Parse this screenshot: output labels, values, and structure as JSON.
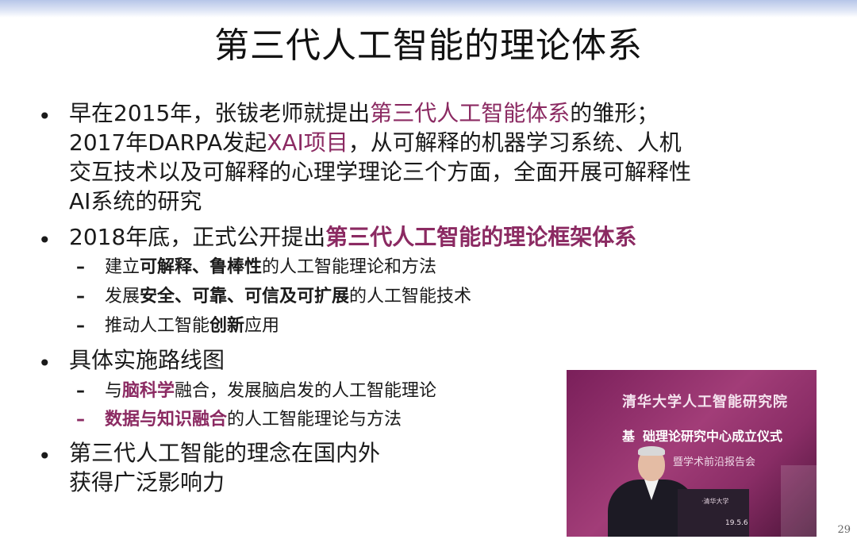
{
  "title": "第三代人工智能的理论体系",
  "bullets": [
    {
      "lines": [
        {
          "pre": "早在2015年，张钹老师就提出",
          "hl": "第三代人工智能体系",
          "post": "的雏形；"
        },
        {
          "pre": "2017年DARPA发起",
          "hl": "XAI项目",
          "post": "，从可解释的机器学习系统、人机"
        },
        {
          "text": "交互技术以及可解释的心理学理论三个方面，全面开展可解释性"
        },
        {
          "text": "AI系统的研究"
        }
      ]
    },
    {
      "lines": [
        {
          "pre": "2018年底，正式公开提出",
          "hl": "第三代人工智能的理论框架体系",
          "post": ""
        }
      ],
      "subs": [
        {
          "pre": "建立",
          "b": "可解释、鲁棒性",
          "post": "的人工智能理论和方法"
        },
        {
          "pre": "发展",
          "b": "安全、可靠、可信及可扩展",
          "post": "的人工智能技术"
        },
        {
          "pre": "推动人工智能",
          "b": "创新",
          "post": "应用"
        }
      ]
    },
    {
      "lines": [
        {
          "text": "具体实施路线图"
        }
      ],
      "subs": [
        {
          "pre": "与",
          "b": "脑科学",
          "post": "融合，发展脑启发的人工智能理论"
        },
        {
          "pre": "",
          "hlb": "数据与知识融合",
          "post": "的人工智能理论与方法"
        }
      ]
    },
    {
      "lines": [
        {
          "text": "第三代人工智能的理念在国内外"
        },
        {
          "text": "获得广泛影响力"
        }
      ]
    }
  ],
  "photo": {
    "banner_line1": "清华大学人工智能研究院",
    "banner_line2_partial": "基",
    "banner_line2": "础理论研究中心成立仪式",
    "banner_line3": "暨学术前沿报告会",
    "podium_text": "·清华大学",
    "date_text": "19.5.6"
  },
  "page_number": "29",
  "colors": {
    "accent": "#8b2a62",
    "top_bar": "#b7c6e8"
  }
}
